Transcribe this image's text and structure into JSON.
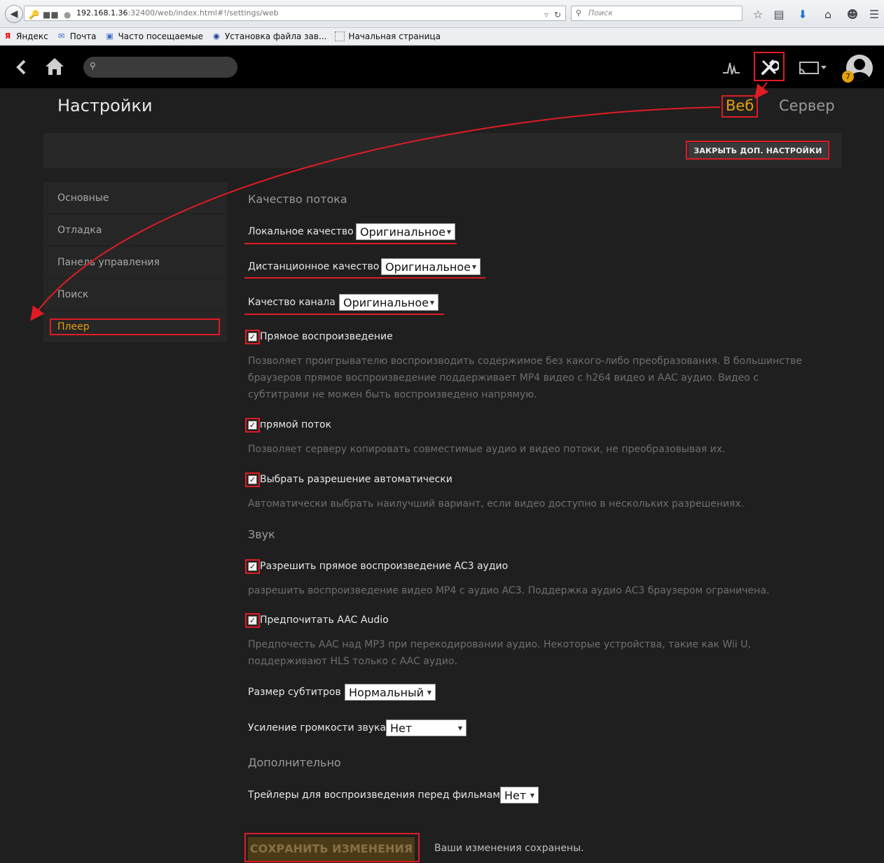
{
  "browser": {
    "url_host": "192.168.1.36",
    "url_path": ":32400/web/index.html#!/settings/web",
    "search_placeholder": "Поиск",
    "bookmarks": [
      {
        "label": "Яндекс",
        "icon": "yandex-icon"
      },
      {
        "label": "Почта",
        "icon": "mail-icon"
      },
      {
        "label": "Часто посещаемые",
        "icon": "page-icon"
      },
      {
        "label": "Установка файла зав...",
        "icon": "qip-icon"
      },
      {
        "label": "Начальная страница",
        "icon": "blank-page-icon"
      }
    ]
  },
  "topbar": {
    "notification_count": "7"
  },
  "header": {
    "title": "Настройки",
    "tabs": {
      "web": "Веб",
      "server": "Сервер"
    },
    "hide_advanced": "ЗАКРЫТЬ ДОП. НАСТРОЙКИ"
  },
  "sidebar": {
    "items": [
      "Основные",
      "Отладка",
      "Панель управления",
      "Поиск",
      "Плеер"
    ],
    "active": "Плеер"
  },
  "content": {
    "stream_quality_title": "Качество потока",
    "local_quality": {
      "label": "Локальное качество",
      "value": "Оригинальное"
    },
    "remote_quality": {
      "label": "Дистанционное качество",
      "value": "Оригинальное"
    },
    "channel_quality": {
      "label": "Качество канала",
      "value": "Оригинальное"
    },
    "direct_play": {
      "label": "Прямое воспроизведение",
      "desc": "Позволяет проигрывателю воспроизводить содержимое без какого-либо преобразования. В большинстве браузеров прямое воспроизведение поддерживает MP4 видео с h264 видео и AAC аудио. Видео с субтитрами не можен быть воспроизведено напрямую."
    },
    "direct_stream": {
      "label": "прямой поток",
      "desc": "Позволяет серверу копировать совместимые аудио и видео потоки, не преобразовывая их."
    },
    "auto_resolution": {
      "label": "Выбрать разрешение автоматически",
      "desc": "Автоматически выбрать наилучший вариант, если видео доступно в нескольких разрешениях."
    },
    "audio_title": "Звук",
    "ac3": {
      "label": "Разрешить прямое воспроизведение AC3 аудио",
      "desc": "разрешить воспроизведение видео MP4 с аудио AC3. Поддержка аудио AC3 браузером ограничена."
    },
    "aac": {
      "label": "Предпочитать AAC Audio",
      "desc": "Предпочесть AAC над MP3 при перекодировании аудио. Некоторые устройства, такие как Wii U, поддерживают HLS только с AAC аудио."
    },
    "subtitle_size": {
      "label": "Размер субтитров",
      "value": "Нормальный"
    },
    "volume_boost": {
      "label": "Усиление громкости звука",
      "value": "Нет"
    },
    "extra_title": "Дополнительно",
    "trailers": {
      "label": "Трейлеры для воспроизведения перед фильмами",
      "value": "Нет"
    },
    "save_label": "СОХРАНИТЬ ИЗМЕНЕНИЯ",
    "save_status": "Ваши изменения сохранены."
  },
  "colors": {
    "accent": "#e5a00d",
    "annotation": "#e01b24",
    "background": "#1f1f1f"
  }
}
